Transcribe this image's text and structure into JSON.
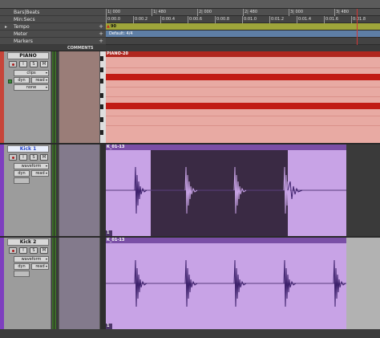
{
  "ruler": {
    "rows": [
      {
        "label": "Bars|Beats",
        "arrow": "",
        "plus": ""
      },
      {
        "label": "Min:Secs",
        "arrow": "",
        "plus": ""
      },
      {
        "label": "Tempo",
        "arrow": "▸",
        "plus": "+"
      },
      {
        "label": "Meter",
        "arrow": "",
        "plus": "+"
      },
      {
        "label": "Markers",
        "arrow": "",
        "plus": "+"
      }
    ],
    "bars_ticks": [
      "1| 000",
      "1| 480",
      "2| 000",
      "2| 480",
      "3| 000",
      "3| 480"
    ],
    "mins_ticks": [
      "0:00.0",
      "0:00.2",
      "0:00.4",
      "0:00.6",
      "0:00.8",
      "0:01.0",
      "0:01.2",
      "0:01.4",
      "0:01.6",
      "0:01.8"
    ],
    "tempo_value": "90",
    "meter_value": "Default: 4/4"
  },
  "header": {
    "comments_label": "COMMENTS"
  },
  "tracks": [
    {
      "name": "PIANO",
      "buttons": [
        "",
        "I",
        "S",
        "M"
      ],
      "view_mode": "clips",
      "dyn_label": "dyn",
      "auto_mode": "read",
      "voice": "none",
      "clip_name": "PIANO-20",
      "color": "#c7453a"
    },
    {
      "name": "Kick 1",
      "buttons": [
        "",
        "I",
        "S",
        "M"
      ],
      "view_mode": "waveform",
      "dyn_label": "dyn",
      "auto_mode": "read",
      "clip_name": "K_01-13",
      "clip_footer": "1",
      "color": "#7e3fbf"
    },
    {
      "name": "Kick 2",
      "buttons": [
        "",
        "I",
        "S",
        "M"
      ],
      "view_mode": "waveform",
      "dyn_label": "dyn",
      "auto_mode": "read",
      "clip_name": "K_01-13",
      "clip_footer": "1",
      "color": "#7e3fbf"
    }
  ],
  "colors": {
    "piano_clip": "#e8aaa3",
    "piano_notes": "#c11b14",
    "kick_clip": "#c8a3e6",
    "selection": "#3a2a44",
    "waveform": "#3b1f6a"
  }
}
